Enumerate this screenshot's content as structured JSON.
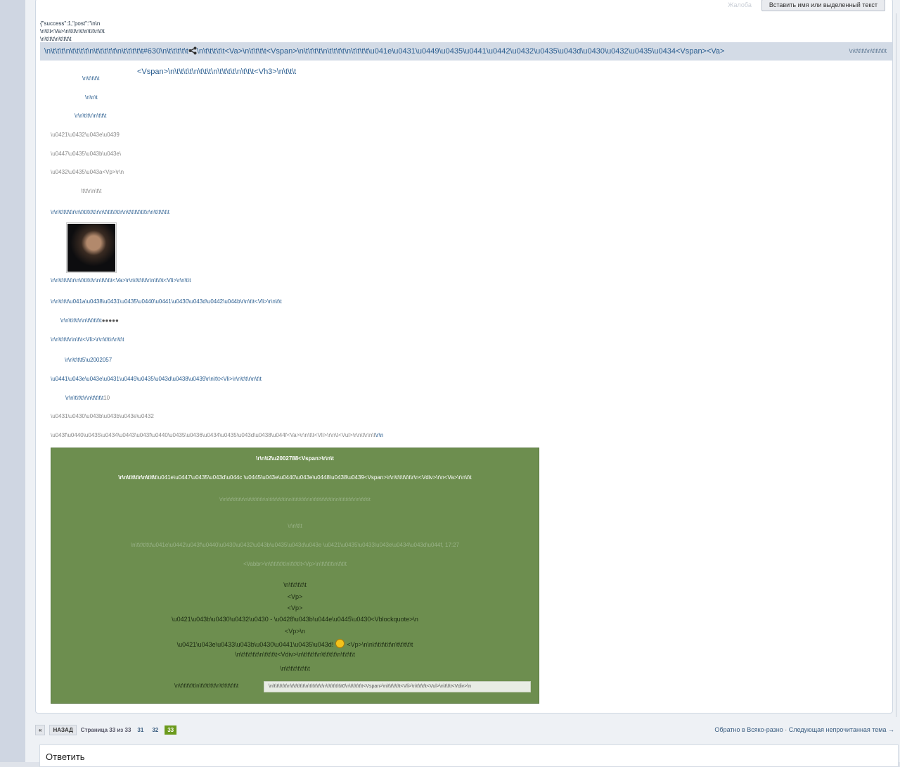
{
  "toolbar": {
    "report_label": "Жалоба",
    "quote_button": "Вставить имя или выделенный текст"
  },
  "raw": {
    "line1": "{\"success\":1,\"post\":\"\\n\\n",
    "line2": "\\n\\t\\t<Va>\\n\\t\\t\\n\\t\\n\\t\\t\\n\\t\\t",
    "line3": "\\n\\t\\t\\t\\n\\t\\t\\t\\t"
  },
  "header": {
    "title_left": "\\n\\t\\t\\t\\n\\t\\t\\t\\t\\n\\t\\t\\t\\t\\t\\n\\t\\t\\t\\t\\t#630\\n\\t\\t\\t\\t\\t",
    "title_right": "\\n\\t\\t\\t\\t\\t<Va>\\n\\t\\t\\t\\t<Vspan>\\n\\t\\t\\t\\t\\n\\t\\t\\t\\t\\n\\t\\t\\t\\t\\u041e\\u0431\\u0449\\u0435\\u0441\\u0442\\u0432\\u0435\\u043d\\u0430\\u0432\\u0435\\u0434<Vspan><Va>",
    "right_text": "\\n\\t\\t\\t\\t\\n\\t\\t\\t\\t\\t",
    "sub_line": "<Vspan>\\n\\t\\t\\t\\t\\n\\t\\t\\t\\n\\t\\t\\t\\t\\n\\t\\t\\t<Vh3>\\n\\t\\t\\t"
  },
  "lines": {
    "l1": "\\n\\t\\t\\t\\t",
    "l2": "\\n\\n\\t",
    "l3": "\\r\\n\\t\\t\\r\\n\\t\\t\\t",
    "l4": "\\u0421\\u0432\\u043e\\u0439",
    "l5": "\\u0447\\u0435\\u043b\\u043e\\",
    "l6": "\\u0432\\u0435\\u043a<Vp>\\r\\n",
    "l7": "\\t\\t\\r\\n\\t\\t",
    "l8": "\\r\\n\\t\\t\\t\\t\\r\\n\\t\\t\\t\\t\\t\\r\\n\\t\\t\\t\\t\\t\\r\\n\\t\\t\\t\\t\\t\\t\\r\\n\\t\\t\\t\\t\\t",
    "l9": "\\r\\n\\t\\t\\t\\t\\r\\n\\t\\t\\t\\t\\r\\n\\t\\t\\t\\t<Va>\\r\\n\\t\\t\\t\\t\\r\\n\\t\\t\\t<Vli>\\r\\n\\t\\t",
    "l10": "\\r\\n\\t\\t\\t\\u041a\\u0438\\u0431\\u0435\\u0440\\u0441\\u0430\\u043d\\u0442\\u044b\\r\\n\\t\\t<Vli>\\r\\n\\t\\t",
    "l11": "\\r\\n\\t\\t\\t\\r\\n\\t\\t\\t\\t\\t",
    "l11_dots": "●●●●●",
    "l12": "\\r\\n\\t\\t\\t\\r\\n\\t\\t<Vli>\\r\\n\\t\\t\\r\\n\\t\\t",
    "l13": "\\r\\n\\t\\t\\t5\\u2002057",
    "l14": "\\u0441\\u043e\\u043e\\u0431\\u0449\\u0435\\u043d\\u0438\\u0439\\r\\n\\t\\t<Vli>\\r\\n\\t\\t\\r\\n\\t\\t",
    "l15": "\\r\\n\\t\\t\\t\\r\\n\\t\\t\\t\\t",
    "l15_num": "10",
    "l16": "\\u0431\\u0430\\u043b\\u043b\\u043e\\u0432",
    "l17": "\\u043f\\u0440\\u0435\\u0434\\u0443\\u043f\\u0440\\u0435\\u0436\\u0434\\u0435\\u043d\\u0438\\u044f<Va>\\r\\n\\t\\t<Vli>\\r\\n\\t<Vul>\\r\\n\\t\\r\\n\\t",
    "l17_tail": "\\r\\n"
  },
  "quote": {
    "q1": "\\r\\n\\t2\\u2002788<Vspan>\\r\\n\\t",
    "q2_bold": "\\r\\n\\t\\t\\t\\r\\n\\t\\t\\t",
    "q2_rest": "\\u041e\\u0447\\u0435\\u043d\\u044c \\u0445\\u043e\\u0440\\u043e\\u0448\\u0438\\u0439<Vspan>\\r\\n\\t\\t\\t\\t\\t\\r\\n<Vdiv>\\r\\n<Va>\\r\\n\\t\\t",
    "q3": "\\r\\n\\t\\t\\t\\t\\t\\r\\n\\t\\t\\t\\t\\t\\r\\n\\t\\t\\t\\t\\t\\t\\r\\n\\t\\t\\t\\t\\t\\r\\n\\t\\t\\t\\t\\t\\t\\t\\r\\n\\t\\t\\t\\t\\t\\r\\n\\t\\t\\t\\t",
    "q4": "\\r\\n\\t\\t",
    "q5": "\\n\\t\\t\\t\\t\\t\\u041e\\u0442\\u043f\\u0440\\u0430\\u0432\\u043b\\u0435\\u043d\\u043e \\u0421\\u0435\\u0433\\u043e\\u0434\\u043d\\u044f, 17:27",
    "q6": "<Vabbr>\\n\\t\\t\\t\\t\\t\\n\\t\\t\\t\\t<Vp>\\n\\t\\t\\t\\t\\n\\t\\t\\t",
    "q7": "\\n\\t\\t\\t\\t\\t",
    "q8": "<Vp>",
    "q9": "<Vp>",
    "q10": "\\u0421\\u043b\\u0430\\u0432\\u0430 - \\u0428\\u043b\\u044e\\u0445\\u0430<Vblockquote>\\n",
    "q11": "<Vp>\\n",
    "q12_a": "\\u0421\\u043e\\u0433\\u043b\\u0430\\u0441\\u0435\\u043d!",
    "q12_b": "<Vp>\\n\\n\\t\\t\\t\\t\\t\\n\\t\\t\\t\\t\\t",
    "q13": "\\n\\t\\t\\t\\t\\t\\n\\t\\t\\t\\t<Vdiv>\\n\\t\\t\\t\\t\\n\\t\\t\\t\\t\\n\\t\\t\\t\\t",
    "q14": "\\n\\t\\t\\t\\t\\t\\t\\t",
    "q15_left": "\\n\\t\\t\\t\\t\\t\\n\\t\\t\\t\\t\\t\\n\\t\\t\\t\\t\\t\\t",
    "q15_code": "\\n\\t\\t\\t\\t\\t\\n\\t\\t\\t\\t\\t\\n\\t\\t\\t\\t\\t\\n\\t\\t\\t\\t\\t\\t0\\n\\t\\t\\t\\t\\t<Vspan>\\n\\t\\t\\t\\t\\t<Vli>\\n\\t\\t\\t\\t<Vul>\\n\\t\\t\\t<Vdiv>\\n"
  },
  "pager": {
    "prev": "«",
    "back": "НАЗАД",
    "page_info": "Страница 33 из 33",
    "p31": "31",
    "p32": "32",
    "p33": "33"
  },
  "nav": {
    "back_link": "Обратно в Всяко-разно",
    "sep": " · ",
    "next_link": "Следующая непрочитанная тема →"
  },
  "reply": {
    "title": "Ответить"
  }
}
